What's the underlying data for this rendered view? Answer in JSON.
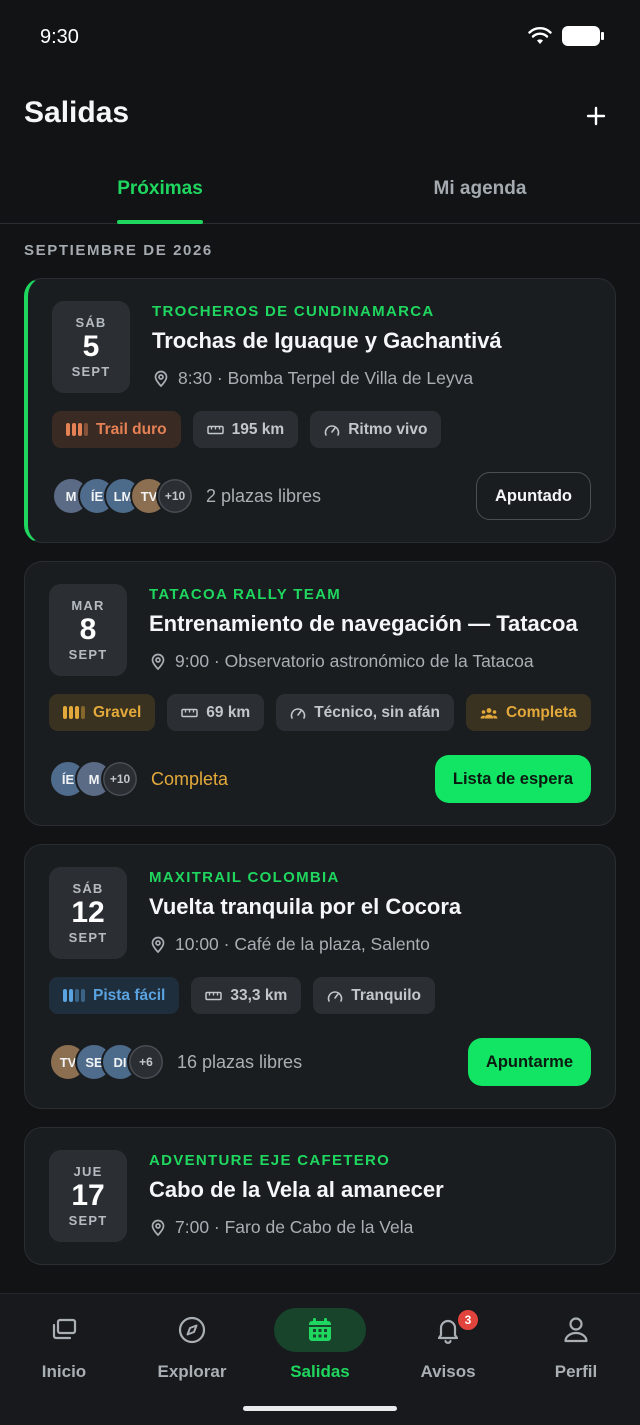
{
  "status": {
    "time": "9:30"
  },
  "header": {
    "title": "Salidas"
  },
  "tabs": [
    {
      "label": "Próximas",
      "active": true
    },
    {
      "label": "Mi agenda",
      "active": false
    }
  ],
  "section": {
    "label": "SEPTIEMBRE DE 2026"
  },
  "rides": [
    {
      "dow": "SÁB",
      "day": "5",
      "month": "SEPT",
      "org": "TROCHEROS DE CUNDINAMARCA",
      "title": "Trochas de Iguaque y Gachantivá",
      "meta": "8:30 · Bomba Terpel de Villa de Leyva",
      "difficulty": "Trail duro",
      "distance": "195 km",
      "pace": "Ritmo vivo",
      "avatars": [
        "M",
        "ÍE",
        "LM",
        "TV"
      ],
      "more": "+10",
      "spots": "2 plazas libres",
      "action": "Apuntado"
    },
    {
      "dow": "MAR",
      "day": "8",
      "month": "SEPT",
      "org": "TATACOA RALLY TEAM",
      "title": "Entrenamiento de navegación — Tatacoa",
      "meta": "9:00 · Observatorio astronómico de la Tatacoa",
      "difficulty": "Gravel",
      "distance": "69 km",
      "pace": "Técnico, sin afán",
      "status_chip": "Completa",
      "avatars": [
        "ÍE",
        "M"
      ],
      "more": "+10",
      "spots": "Completa",
      "action": "Lista de espera"
    },
    {
      "dow": "SÁB",
      "day": "12",
      "month": "SEPT",
      "org": "MAXITRAIL COLOMBIA",
      "title": "Vuelta tranquila por el Cocora",
      "meta": "10:00 · Café de la plaza, Salento",
      "difficulty": "Pista fácil",
      "distance": "33,3 km",
      "pace": "Tranquilo",
      "avatars": [
        "TV",
        "SE",
        "DI"
      ],
      "more": "+6",
      "spots": "16 plazas libres",
      "action": "Apuntarme"
    },
    {
      "dow": "JUE",
      "day": "17",
      "month": "SEPT",
      "org": "ADVENTURE EJE CAFETERO",
      "title": "Cabo de la Vela al amanecer",
      "meta": "7:00 · Faro de Cabo de la Vela"
    }
  ],
  "nav": [
    {
      "label": "Inicio",
      "icon": "stack-icon"
    },
    {
      "label": "Explorar",
      "icon": "compass-icon"
    },
    {
      "label": "Salidas",
      "icon": "calendar-icon",
      "active": true
    },
    {
      "label": "Avisos",
      "icon": "bell-icon",
      "badge": "3"
    },
    {
      "label": "Perfil",
      "icon": "person-icon"
    }
  ],
  "colors": {
    "accent": "#1fd65f",
    "button_primary": "#11e563",
    "hard": "#e58255",
    "gravel": "#e3a93b",
    "easy": "#5aa3e0",
    "badge": "#e0443c"
  }
}
